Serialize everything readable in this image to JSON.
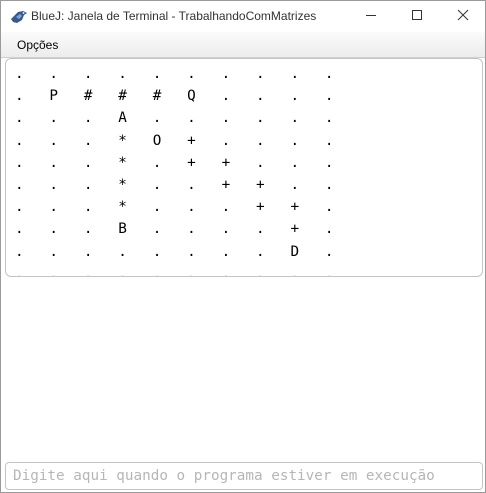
{
  "window": {
    "title": "BlueJ: Janela de Terminal - TrabalhandoComMatrizes",
    "controls": [
      "minimize-icon",
      "maximize-icon",
      "close-icon"
    ]
  },
  "menubar": {
    "items": [
      {
        "label": "Opções"
      }
    ]
  },
  "terminal": {
    "output": ".   .   .   .   .   .   .   .   .   .\n.   P   #   #   #   Q   .   .   .   .\n.   .   .   A   .   .   .   .   .   .\n.   .   .   *   O   +   .   .   .   .\n.   .   .   *   .   +   +   .   .   .\n.   .   .   *   .   .   +   +   .   .\n.   .   .   *   .   .   .   +   +   .\n.   .   .   B   .   .   .   .   +   .\n.   .   .   .   .   .   .   .   D   .\n.   .   .   .   .   .   .   .   .   .",
    "input_placeholder": "Digite aqui quando o programa estiver em execução",
    "input_value": ""
  },
  "colors": {
    "titlebar": "#ffffff",
    "menubar": "#f0f0f0",
    "border": "#c4c4c4",
    "placeholder": "#b6b6b6"
  }
}
